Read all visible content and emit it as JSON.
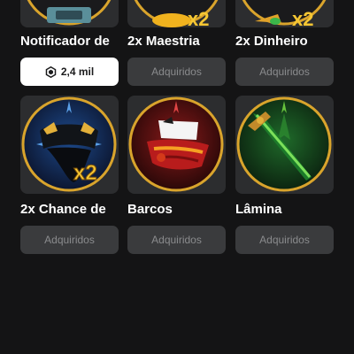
{
  "items": [
    {
      "name": "Notificador de",
      "button": "2,4 mil",
      "owned": false,
      "icon": "notifier-badge-icon"
    },
    {
      "name": "2x Maestria",
      "button": "Adquiridos",
      "owned": true,
      "icon": "mastery-x2-icon"
    },
    {
      "name": "2x Dinheiro",
      "button": "Adquiridos",
      "owned": true,
      "icon": "money-x2-icon"
    },
    {
      "name": "2x Chance de",
      "button": "Adquiridos",
      "owned": true,
      "icon": "captain-hat-x2-icon"
    },
    {
      "name": "Barcos",
      "button": "Adquiridos",
      "owned": true,
      "icon": "pirate-boat-icon"
    },
    {
      "name": "Lâmina",
      "button": "Adquiridos",
      "owned": true,
      "icon": "green-sword-icon"
    }
  ],
  "price_icon": "robux-icon",
  "colors": {
    "background": "#141415",
    "card": "#2c2d2f",
    "owned_button": "#3a3b3d",
    "price_button": "#ffffff",
    "gold_ring": "#d9a42c"
  }
}
